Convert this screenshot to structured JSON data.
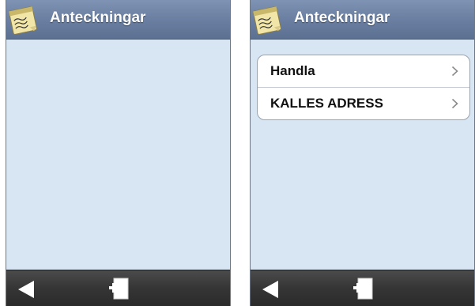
{
  "screens": [
    {
      "title": "Anteckningar",
      "notes": []
    },
    {
      "title": "Anteckningar",
      "notes": [
        {
          "label": "Handla"
        },
        {
          "label": "KALLES ADRESS"
        }
      ]
    }
  ],
  "toolbar": {
    "back_icon": "back-triangle-icon",
    "new_note_icon": "new-note-icon"
  },
  "app_icon": "notepad-icon",
  "colors": {
    "titlebar": "#6a7fa1",
    "content_background": "#d8e6f4",
    "toolbar": "#353535",
    "list_background": "#ffffff"
  }
}
